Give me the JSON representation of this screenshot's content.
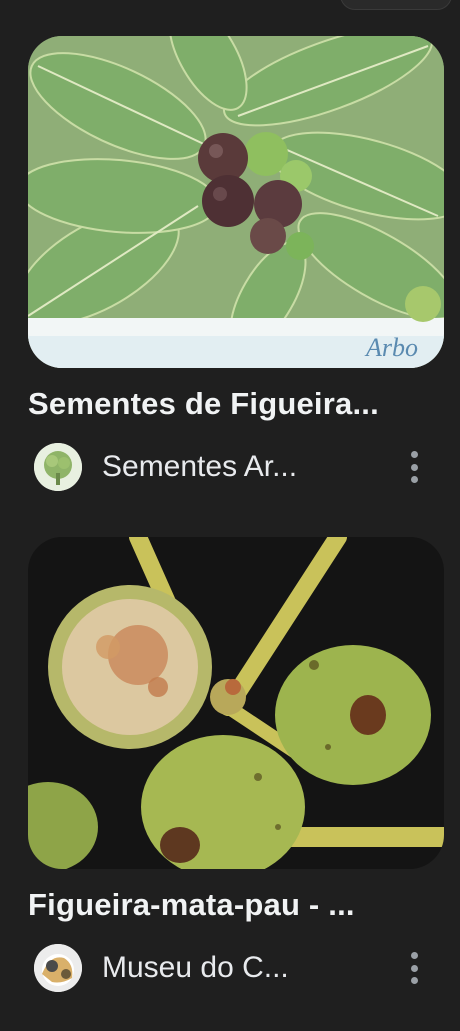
{
  "results": [
    {
      "title": "Sementes de Figueira...",
      "source": "Sementes Ar...",
      "watermark": "Arbo",
      "image_icon": "figueira-fruits-leaves-image",
      "avatar_icon": "arbocenter-avatar-icon"
    },
    {
      "title": "Figueira-mata-pau - ...",
      "source": "Museu do C...",
      "image_icon": "figueira-mata-pau-fruits-image",
      "avatar_icon": "museu-avatar-icon"
    }
  ],
  "colors": {
    "background": "#1f1f1f",
    "text": "#e8eaed",
    "muted": "#9aa0a6"
  }
}
